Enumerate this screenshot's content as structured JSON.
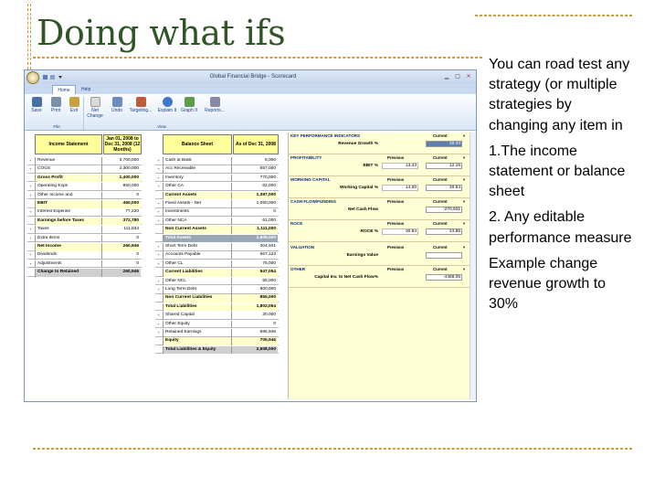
{
  "slide": {
    "title": "Doing what ifs",
    "paragraphs": [
      "You can road test any strategy (or multiple strategies by changing any item in",
      "1.The income statement or balance sheet",
      "2. Any editable performance measure",
      "Example change revenue growth to 30%"
    ]
  },
  "window": {
    "title": "Global Financial Bridge - Scorecard",
    "tabs": [
      "Home",
      "Help"
    ],
    "toolbar": {
      "save": "Save",
      "print": "Print",
      "exit": "Exit",
      "net_change": "Net Change",
      "undo": "Undo",
      "targeting": "Targeting...",
      "explain": "Explain It",
      "graph": "Graph It",
      "reports": "Reports..."
    },
    "groups": {
      "file": "File",
      "view": "View"
    }
  },
  "income": {
    "label": "Income Statement",
    "period": "Jan 01, 2008 to Dec 31, 2008 (12 Months)",
    "rows": [
      {
        "label": "Revenue",
        "value": "3,700,000",
        "kind": "item"
      },
      {
        "label": "COGS",
        "value": "2,300,000",
        "kind": "item"
      },
      {
        "label": "Gross Profit",
        "value": "1,400,000",
        "kind": "sub"
      },
      {
        "label": "Operating Exps",
        "value": "950,000",
        "kind": "item"
      },
      {
        "label": "Other Income and",
        "value": "0",
        "kind": "item"
      },
      {
        "label": "EBIT",
        "value": "450,000",
        "kind": "sub"
      },
      {
        "label": "Interest Expense",
        "value": "77,220",
        "kind": "item"
      },
      {
        "label": "Earnings before Taxes",
        "value": "372,780",
        "kind": "sub"
      },
      {
        "label": "Taxes",
        "value": "111,834",
        "kind": "item"
      },
      {
        "label": "Extra Items",
        "value": "0",
        "kind": "item"
      },
      {
        "label": "Net Income",
        "value": "260,946",
        "kind": "sub"
      },
      {
        "label": "Dividends",
        "value": "0",
        "kind": "item"
      },
      {
        "label": "Adjustments",
        "value": "0",
        "kind": "item"
      },
      {
        "label": "Change to Retained",
        "value": "260,946",
        "kind": "tot"
      }
    ]
  },
  "balance": {
    "label": "Balance Sheet",
    "period": "As of Dec 31, 2008",
    "rows": [
      {
        "label": "Cash at Bank",
        "value": "8,000",
        "kind": "item"
      },
      {
        "label": "Acc Receivable",
        "value": "557,000",
        "kind": "item"
      },
      {
        "label": "Inventory",
        "value": "770,000",
        "kind": "item"
      },
      {
        "label": "Other CA",
        "value": "62,000",
        "kind": "item"
      },
      {
        "label": "Current Assets",
        "value": "1,397,000",
        "kind": "sub"
      },
      {
        "label": "Fixed Assets - Net",
        "value": "1,050,000",
        "kind": "item"
      },
      {
        "label": "Investments",
        "value": "0",
        "kind": "item"
      },
      {
        "label": "Other NCA",
        "value": "61,000",
        "kind": "item"
      },
      {
        "label": "Non Current Assets",
        "value": "1,111,000",
        "kind": "sub"
      },
      {
        "label": "Total Assets",
        "value": "2,508,000",
        "kind": "sel"
      },
      {
        "label": "Short Term Debt",
        "value": "304,931",
        "kind": "item"
      },
      {
        "label": "Accounts Payable",
        "value": "567,123",
        "kind": "item"
      },
      {
        "label": "Other CL",
        "value": "75,000",
        "kind": "item"
      },
      {
        "label": "Current Liabilities",
        "value": "947,054",
        "kind": "sub"
      },
      {
        "label": "Other NCL",
        "value": "55,000",
        "kind": "item"
      },
      {
        "label": "Long Term Debt",
        "value": "800,000",
        "kind": "item"
      },
      {
        "label": "Non Current Liabilities",
        "value": "855,000",
        "kind": "sub"
      },
      {
        "label": "Total Liabilities",
        "value": "1,802,054",
        "kind": "sub"
      },
      {
        "label": "Shared Capital",
        "value": "20,000",
        "kind": "item"
      },
      {
        "label": "Other Equity",
        "value": "0",
        "kind": "item"
      },
      {
        "label": "Retained Earnings",
        "value": "685,946",
        "kind": "item"
      },
      {
        "label": "Equity",
        "value": "705,946",
        "kind": "sub"
      },
      {
        "label": "Total Liabilities & Equity",
        "value": "2,508,000",
        "kind": "tot"
      }
    ]
  },
  "kpi": [
    {
      "title": "KEY PERFORMANCE INDICATORS",
      "name": "Revenue Growth %",
      "previous": "",
      "current": "28.33",
      "prev_header": "",
      "cur_header": "Current"
    },
    {
      "title": "PROFITABILITY",
      "name": "EBIT %",
      "previous": "13.33",
      "current": "12.16",
      "prev_header": "Previous",
      "cur_header": "Current"
    },
    {
      "title": "WORKING CAPITAL",
      "name": "Working Capital %",
      "previous": "14.00",
      "current": "20.54",
      "prev_header": "Previous",
      "cur_header": "Current"
    },
    {
      "title": "CASH FLOW/FUNDING",
      "name": "Net Cash Flow",
      "previous": "",
      "current": "-270,931",
      "prev_header": "Previous",
      "cur_header": "Current"
    },
    {
      "title": "ROCE",
      "name": "ROCE %",
      "previous": "30.84",
      "current": "24.85",
      "prev_header": "Previous",
      "cur_header": "Current"
    },
    {
      "title": "VALUATION",
      "name": "Earnings Value",
      "previous": "",
      "current": "",
      "prev_header": "Previous",
      "cur_header": "Current"
    },
    {
      "title": "OTHER",
      "name": "Capital Inv. to Net Cash Flow%",
      "previous": "",
      "current": "-4468.05",
      "prev_header": "Previous",
      "cur_header": "Current"
    }
  ]
}
